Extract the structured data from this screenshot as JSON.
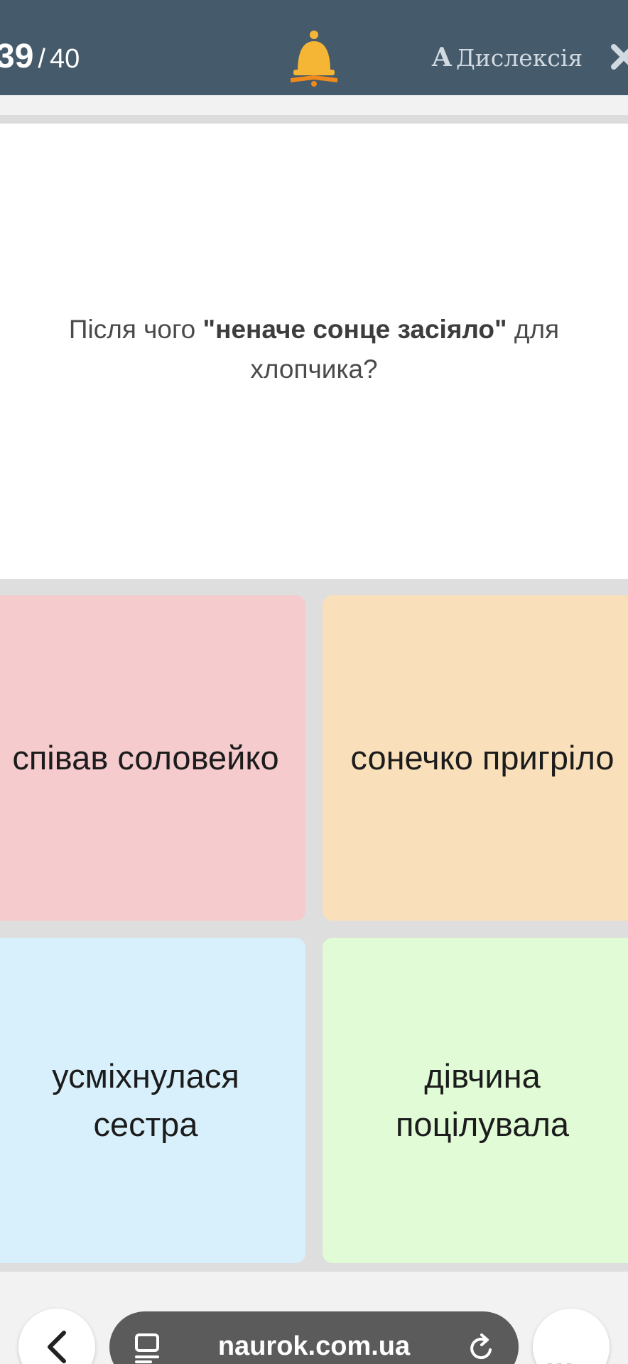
{
  "header": {
    "question_current": "39",
    "separator": "/",
    "question_total": "40",
    "dyslexia_letter": "A",
    "dyslexia_label": "Дислексія",
    "bell_color": "#f5b535",
    "bar_color": "#455a6b"
  },
  "question": {
    "prefix": "Після чого ",
    "highlight": "\"неначе сонце засіяло\"",
    "suffix": " для хлопчика?"
  },
  "answers": [
    {
      "text": "співав соловейко",
      "color": "#f5cbce"
    },
    {
      "text": "сонечко пригріло",
      "color": "#f9e0bb"
    },
    {
      "text": "усміхнулася сестра",
      "color": "#d8f0fb"
    },
    {
      "text": "дівчина поцілувала",
      "color": "#e1fbd6"
    }
  ],
  "browser": {
    "url": "naurok.com.ua",
    "more_label": "..."
  }
}
